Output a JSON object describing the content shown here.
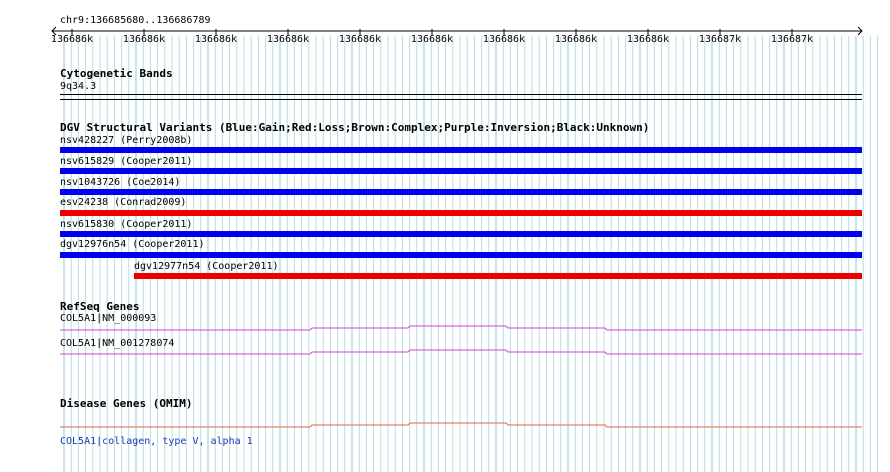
{
  "coordinates": "chr9:136685680..136686789",
  "ruler": {
    "tick_labels": [
      "136686k",
      "136686k",
      "136686k",
      "136686k",
      "136686k",
      "136686k",
      "136686k",
      "136686k",
      "136686k",
      "136687k",
      "136687k"
    ]
  },
  "cytobands": {
    "title": "Cytogenetic Bands",
    "band": "9q34.3"
  },
  "dgv": {
    "title": "DGV Structural Variants (Blue:Gain;Red:Loss;Brown:Complex;Purple:Inversion;Black:Unknown)",
    "variants": [
      {
        "label": "nsv428227 (Perry2008b)",
        "type": "gain",
        "color": "#0000ee"
      },
      {
        "label": "nsv615829 (Cooper2011)",
        "type": "gain",
        "color": "#0000ee"
      },
      {
        "label": "nsv1043726 (Coe2014)",
        "type": "gain",
        "color": "#0000ee"
      },
      {
        "label": "esv24238 (Conrad2009)",
        "type": "loss",
        "color": "#ee0000"
      },
      {
        "label": "nsv615830 (Cooper2011)",
        "type": "gain",
        "color": "#0000ee"
      },
      {
        "label": "dgv12976n54 (Cooper2011)",
        "type": "gain",
        "color": "#0000ee"
      },
      {
        "label": "dgv12977n54 (Cooper2011)",
        "type": "loss",
        "color": "#ee0000"
      }
    ]
  },
  "refseq": {
    "title": "RefSeq Genes",
    "genes": [
      {
        "label": "COL5A1|NM_000093",
        "color": "#cc44cc"
      },
      {
        "label": "COL5A1|NM_001278074",
        "color": "#cc44cc"
      }
    ]
  },
  "omim": {
    "title": "Disease Genes (OMIM)",
    "gene_link": "COL5A1|collagen, type V, alpha 1",
    "color": "#dd6644"
  }
}
